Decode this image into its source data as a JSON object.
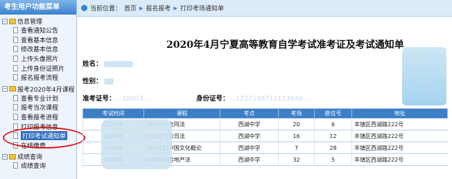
{
  "sidebar": {
    "header": "考生用户功能菜单",
    "groups": [
      {
        "label": "信息管理",
        "toggle": "−",
        "items": [
          "查看通知公告",
          "查看基本信息",
          "修改基本信息",
          "上传头像照片",
          "上传身份证照片",
          "报名报考流程"
        ]
      },
      {
        "label": "报考2020年4月课程",
        "toggle": "−",
        "items": [
          "查看专业计划",
          "报考当次课程",
          "查看报考进程",
          "打印报考信息",
          "打印考试通知单",
          "在线缴费"
        ]
      },
      {
        "label": "成绩查询",
        "toggle": "−",
        "items": [
          "成绩查询"
        ]
      }
    ],
    "selected_item": "打印考试通知单"
  },
  "topbar": {
    "location_label": "当前位置：",
    "crumbs": [
      "首页",
      "报名报考",
      "打印考场通知单"
    ]
  },
  "main": {
    "title": "2020年4月宁夏高等教育自学考试准考证及考试通知单",
    "name_label": "姓名：",
    "gender_label": "性别：",
    "ticket_label": "准考证号：",
    "ticket_value": "…10003…",
    "id_label": "身份证号：",
    "id_value": "…1222199711113646…"
  },
  "table": {
    "headers": [
      "考试时间",
      "课程",
      "考点",
      "考场",
      "座位号",
      "地址"
    ],
    "rows": [
      {
        "time": "2020年",
        "course": "[00230]合同法",
        "site": "西湖中学",
        "room": "20",
        "seat": "6",
        "address": "丰镇区西湖路222号"
      },
      {
        "time": "2020年",
        "course": "[00227]公司法",
        "site": "西湖中学",
        "room": "16",
        "seat": "12",
        "address": "丰镇区西湖路222号"
      },
      {
        "time": "2020年",
        "course": "[00321]中国文化概论",
        "site": "西湖中学",
        "room": "7",
        "seat": "28",
        "address": "丰镇区西湖路222号"
      },
      {
        "time": "2020年",
        "course": "[00169]房地产法",
        "site": "西湖中学",
        "room": "32",
        "seat": "5",
        "address": "丰镇区西湖路222号"
      }
    ]
  },
  "colors": {
    "accent": "#3c7fc6",
    "highlight_circle": "#e3121b"
  }
}
